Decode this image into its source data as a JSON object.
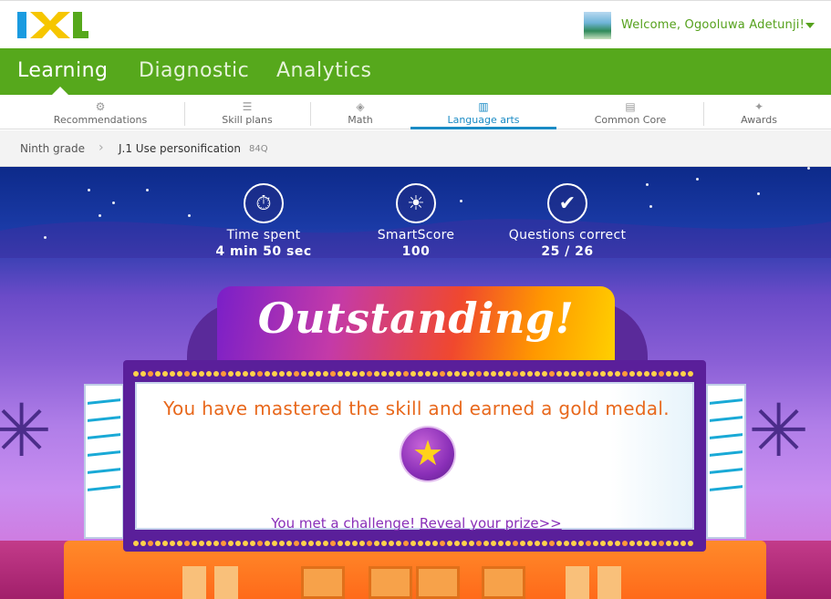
{
  "header": {
    "logo_text": "IXL",
    "welcome": "Welcome, Ogooluwa Adetunji!"
  },
  "greennav": {
    "tabs": [
      {
        "label": "Learning",
        "active": true
      },
      {
        "label": "Diagnostic",
        "active": false
      },
      {
        "label": "Analytics",
        "active": false
      }
    ]
  },
  "subnav": {
    "items": [
      {
        "label": "Recommendations",
        "icon": "recommendations-icon"
      },
      {
        "label": "Skill plans",
        "icon": "skill-plans-icon"
      },
      {
        "label": "Math",
        "icon": "math-icon"
      },
      {
        "label": "Language arts",
        "icon": "book-icon",
        "active": true
      },
      {
        "label": "Common Core",
        "icon": "clipboard-icon"
      },
      {
        "label": "Awards",
        "icon": "awards-icon"
      }
    ]
  },
  "breadcrumb": {
    "grade": "Ninth grade",
    "skill": "J.1 Use personification",
    "code": "84Q"
  },
  "stats": {
    "time_label": "Time spent",
    "time_value": "4 min 50 sec",
    "smartscore_label": "SmartScore",
    "smartscore_value": "100",
    "correct_label": "Questions correct",
    "correct_value": "25 / 26"
  },
  "result": {
    "banner": "Outstanding!",
    "mastered": "You have mastered the skill and earned a gold medal.",
    "challenge_prefix": "You met a challenge!",
    "challenge_link": "Reveal your prize>>"
  },
  "colors": {
    "brand_green": "#56a81c",
    "accent_blue": "#1a8bc5",
    "orange_text": "#e8681c",
    "purple_text": "#8a2fb8"
  }
}
